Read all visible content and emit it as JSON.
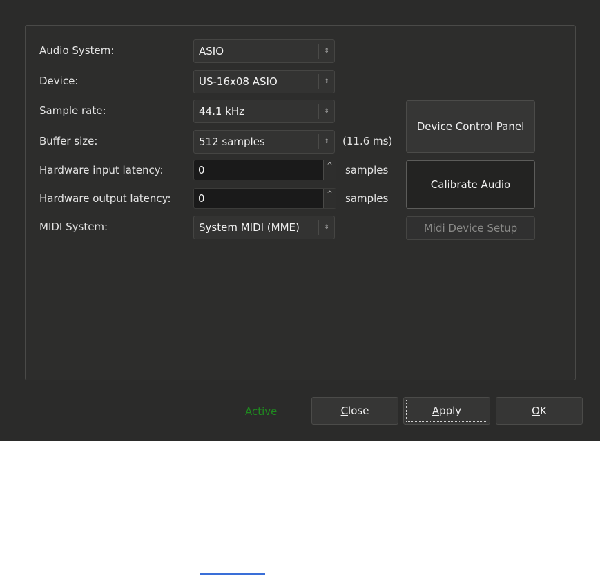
{
  "fields": {
    "audio_system": {
      "label": "Audio System:",
      "value": "ASIO"
    },
    "device": {
      "label": "Device:",
      "value": "US-16x08 ASIO"
    },
    "sample_rate": {
      "label": "Sample rate:",
      "value": "44.1 kHz"
    },
    "buffer_size": {
      "label": "Buffer size:",
      "value": "512 samples",
      "latency_text": "(11.6 ms)"
    },
    "hw_input_latency": {
      "label": "Hardware input latency:",
      "value": "0",
      "unit": "samples"
    },
    "hw_output_latency": {
      "label": "Hardware output latency:",
      "value": "0",
      "unit": "samples"
    },
    "midi_system": {
      "label": "MIDI System:",
      "value": "System MIDI (MME)"
    }
  },
  "side_buttons": {
    "device_control_panel": "Device Control Panel",
    "calibrate_audio": "Calibrate Audio",
    "midi_device_setup": "Midi Device Setup"
  },
  "footer": {
    "status": "Active",
    "close": {
      "mnemonic": "C",
      "rest": "lose"
    },
    "apply": {
      "mnemonic": "A",
      "rest": "pply"
    },
    "ok": {
      "mnemonic": "O",
      "rest": "K"
    }
  },
  "colors": {
    "status_active": "#1f8a1f",
    "background": "#2b2b2a",
    "link_underline": "#3a6fd8"
  },
  "icons": {
    "combo_arrow": "updown-chevron-icon",
    "spin_up": "spin-up-icon"
  }
}
